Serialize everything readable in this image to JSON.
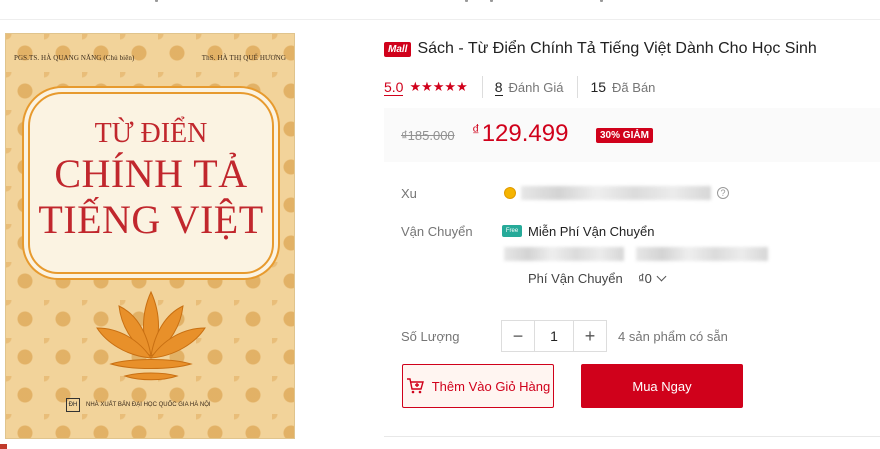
{
  "cover": {
    "author_left": "PGS.TS. HÀ QUANG NĂNG (Chủ biên)",
    "author_right": "ThS. HÀ THỊ QUẾ HƯƠNG",
    "title_line1": "TỪ ĐIỂN",
    "title_line2": "CHÍNH TẢ",
    "title_line3": "TIẾNG VIỆT",
    "publisher": "NHÀ XUẤT BẢN ĐẠI HỌC QUỐC GIA HÀ NỘI"
  },
  "product": {
    "mall_badge": "Mall",
    "title": "Sách - Từ Điển Chính Tả Tiếng Việt Dành Cho Học Sinh",
    "rating_score": "5.0",
    "stars": "★★★★★",
    "review_count": "8",
    "review_label": "Đánh Giá",
    "sold_count": "15",
    "sold_label": "Đã Bán"
  },
  "price": {
    "original": "₫185.000",
    "currency_symbol": "₫",
    "current": "129.499",
    "discount_label": "30% GIẢM"
  },
  "details": {
    "xu_label": "Xu",
    "shipping_label": "Vận Chuyển",
    "free_shipping_icon": "Free",
    "free_shipping_text": "Miễn Phí Vận Chuyển",
    "shipping_fee_label": "Phí Vận Chuyển",
    "shipping_fee_value": "₫0",
    "quantity_label": "Số Lượng",
    "quantity_minus": "−",
    "quantity_value": "1",
    "quantity_plus": "+",
    "stock_text": "4 sản phẩm có sẵn",
    "help_icon": "?"
  },
  "actions": {
    "add_to_cart": "Thêm Vào Giỏ Hàng",
    "buy_now": "Mua Ngay"
  },
  "colors": {
    "accent": "#d0011b",
    "free_ship": "#26aa99",
    "cover_bg": "#f2d39a",
    "cover_title": "#c1272d"
  }
}
